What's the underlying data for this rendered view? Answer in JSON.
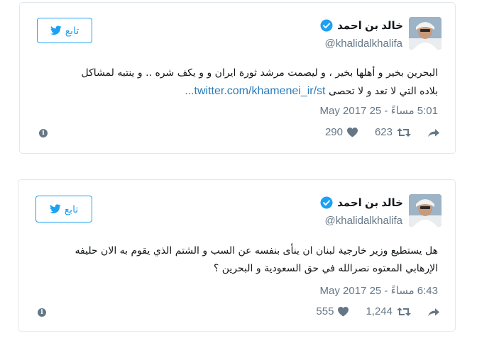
{
  "colors": {
    "brand": "#1da1f2",
    "link": "#2b7bb9",
    "muted": "#657786",
    "border": "#e1e8ed"
  },
  "tweets": [
    {
      "author": {
        "name": "خالد بن احمد",
        "handle": "@khalidalkhalifa",
        "verified": true,
        "avatar_icon": "user-avatar"
      },
      "follow_label": "تابع",
      "text_lines": [
        "البحرين بخير و أهلها بخير ، و ليصمت مرشد ثورة ايران و و يكف شره .. و ينتبه لمشاكل",
        "بلاده التي لا تعد و لا تحصى"
      ],
      "link": "twitter.com/khamenei_ir/st...",
      "timestamp": "5:01 مساءً - 25 May 2017",
      "likes": "290",
      "retweets": "623"
    },
    {
      "author": {
        "name": "خالد بن احمد",
        "handle": "@khalidalkhalifa",
        "verified": true,
        "avatar_icon": "user-avatar"
      },
      "follow_label": "تابع",
      "text_lines": [
        "هل يستطيع وزير خارجية لبنان ان ينأى بنفسه عن السب و الشتم الذي يقوم به الان حليفه",
        "الإرهابي المعتوه نصرالله في حق السعودية و البحرين ؟"
      ],
      "link": "",
      "timestamp": "6:43 مساءً - 25 May 2017",
      "likes": "555",
      "retweets": "1,244"
    }
  ]
}
